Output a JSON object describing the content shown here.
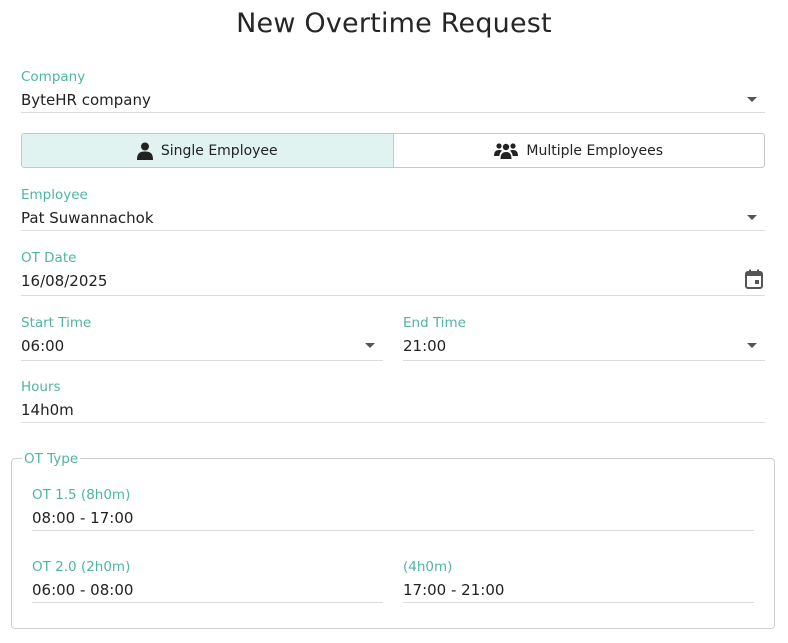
{
  "title": "New Overtime Request",
  "company": {
    "label": "Company",
    "value": "ByteHR company"
  },
  "mode": {
    "single": "Single Employee",
    "multiple": "Multiple Employees",
    "selected": "single"
  },
  "employee": {
    "label": "Employee",
    "value": "Pat Suwannachok"
  },
  "ot_date": {
    "label": "OT Date",
    "value": "16/08/2025"
  },
  "start_time": {
    "label": "Start Time",
    "value": "06:00"
  },
  "end_time": {
    "label": "End Time",
    "value": "21:00"
  },
  "hours": {
    "label": "Hours",
    "value": "14h0m"
  },
  "ot_type": {
    "legend": "OT Type",
    "ot15": {
      "label": "OT 1.5 (8h0m)",
      "value": "08:00 - 17:00"
    },
    "ot20": {
      "label": "OT 2.0 (2h0m)",
      "value": "06:00 - 08:00"
    },
    "extra": {
      "label": "(4h0m)",
      "value": "17:00 - 21:00"
    }
  },
  "colors": {
    "accent": "#4db6a3",
    "toggle_active_bg": "#e1f3f0"
  },
  "icons": {
    "select_caret": "chevron-down-icon",
    "calendar": "calendar-icon",
    "single": "person-icon",
    "multiple": "group-icon"
  }
}
